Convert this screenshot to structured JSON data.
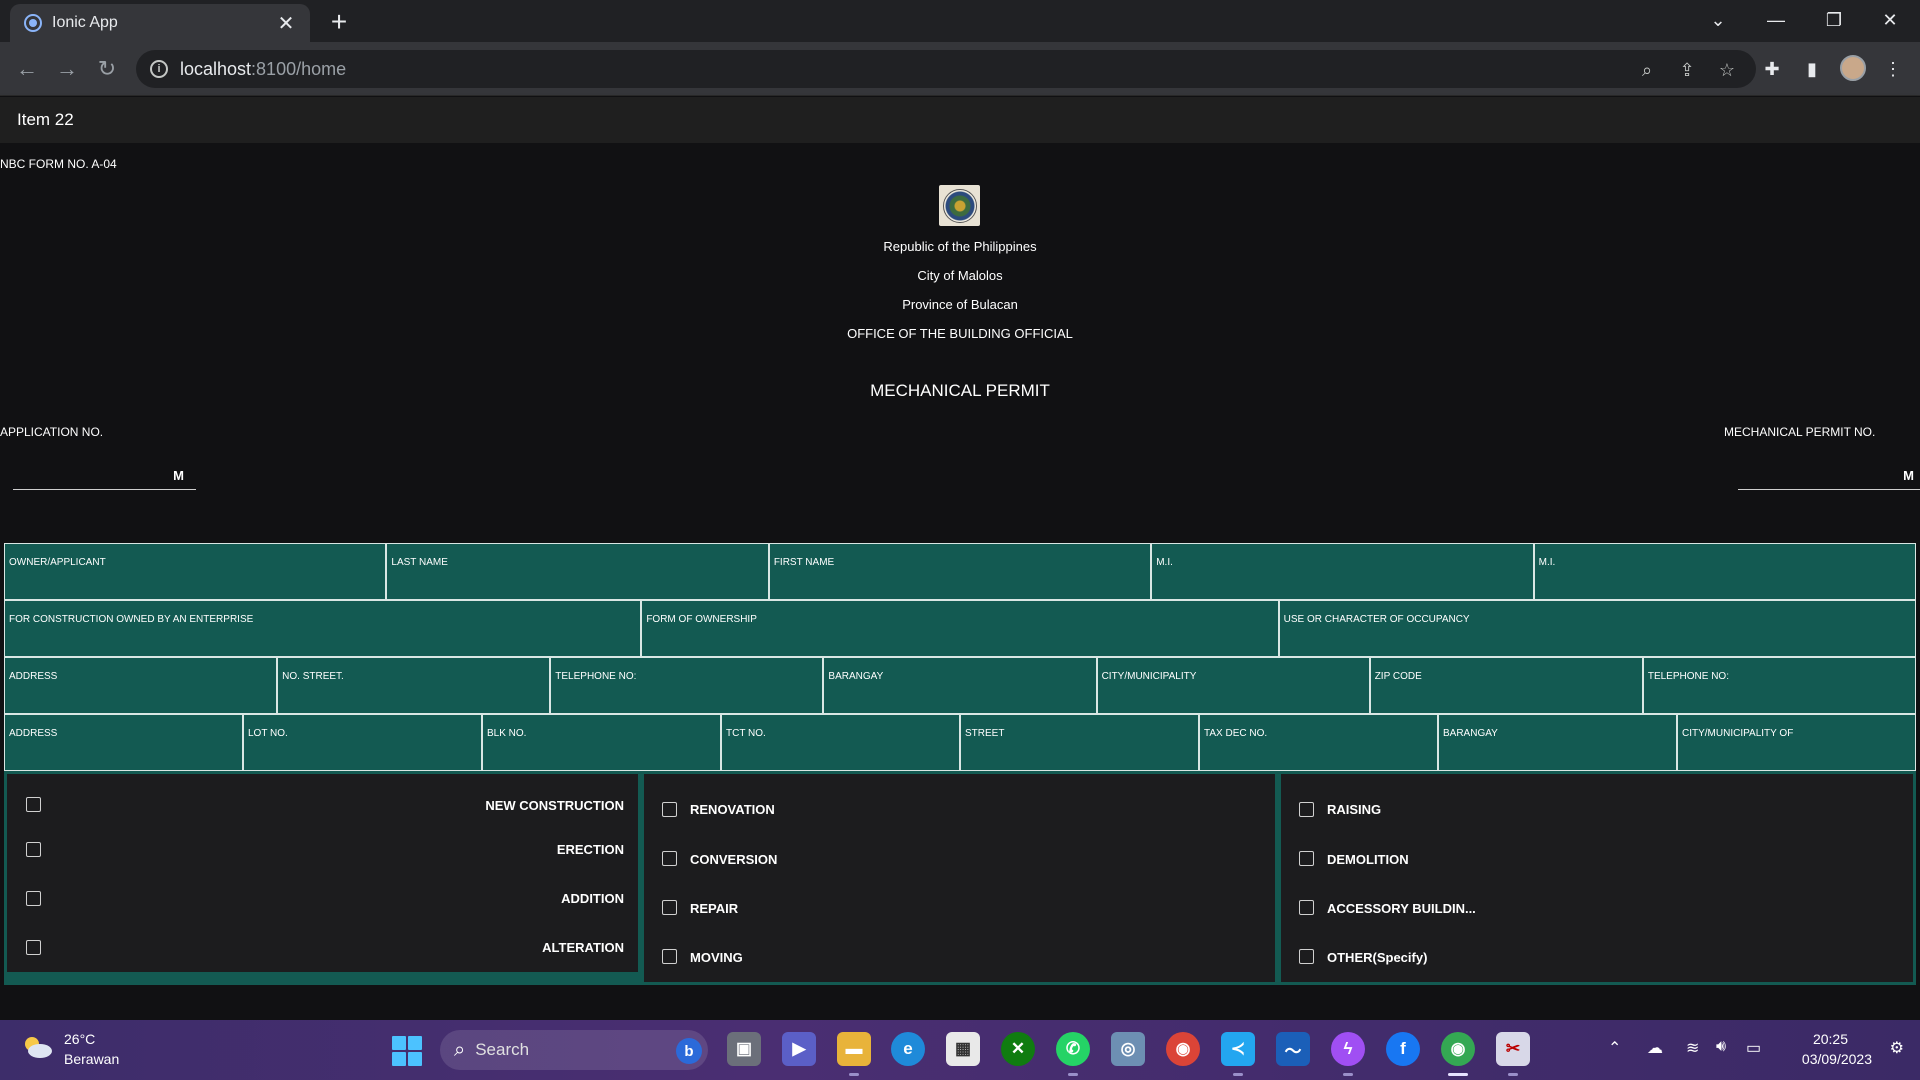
{
  "browser": {
    "tab_title": "Ionic App",
    "tab_close": "✕",
    "new_tab": "+",
    "url_host": "localhost",
    "url_path": ":8100/home"
  },
  "app": {
    "header_title": "Item 22"
  },
  "form": {
    "form_no": "NBC FORM NO. A-04",
    "header_lines": [
      "Republic of the Philippines",
      "City of Malolos",
      "Province of Bulacan",
      "OFFICE OF THE BUILDING OFFICIAL"
    ],
    "permit_title": "MECHANICAL PERMIT",
    "application_no_label": "APPLICATION NO.",
    "application_no_suffix": "M",
    "permit_no_label": "MECHANICAL PERMIT NO.",
    "permit_no_suffix": "M",
    "rows": [
      [
        "OWNER/APPLICANT",
        "LAST NAME",
        "FIRST NAME",
        "M.I.",
        "M.I."
      ],
      [
        "FOR CONSTRUCTION OWNED BY AN ENTERPRISE",
        "FORM OF OWNERSHIP",
        "USE OR CHARACTER OF OCCUPANCY"
      ],
      [
        "ADDRESS",
        "NO. STREET.",
        "TELEPHONE NO:",
        "BARANGAY",
        "CITY/MUNICIPALITY",
        "ZIP CODE",
        "TELEPHONE NO:"
      ],
      [
        "ADDRESS",
        "LOT NO.",
        "BLK NO.",
        "TCT NO.",
        "STREET",
        "TAX DEC NO.",
        "BARANGAY",
        "CITY/MUNICIPALITY OF"
      ]
    ],
    "scope_col1": [
      "NEW CONSTRUCTION",
      "ERECTION",
      "ADDITION",
      "ALTERATION"
    ],
    "scope_col2": [
      "RENOVATION",
      "CONVERSION",
      "REPAIR",
      "MOVING"
    ],
    "scope_col3": [
      "RAISING",
      "DEMOLITION",
      "ACCESSORY BUILDIN...",
      "OTHER(Specify)"
    ]
  },
  "taskbar": {
    "weather_temp": "26°C",
    "weather_desc": "Berawan",
    "search_placeholder": "Search",
    "time": "20:25",
    "date": "03/09/2023"
  },
  "colors": {
    "accent_teal": "#135a52",
    "taskbar_purple": "#4a2e72"
  }
}
